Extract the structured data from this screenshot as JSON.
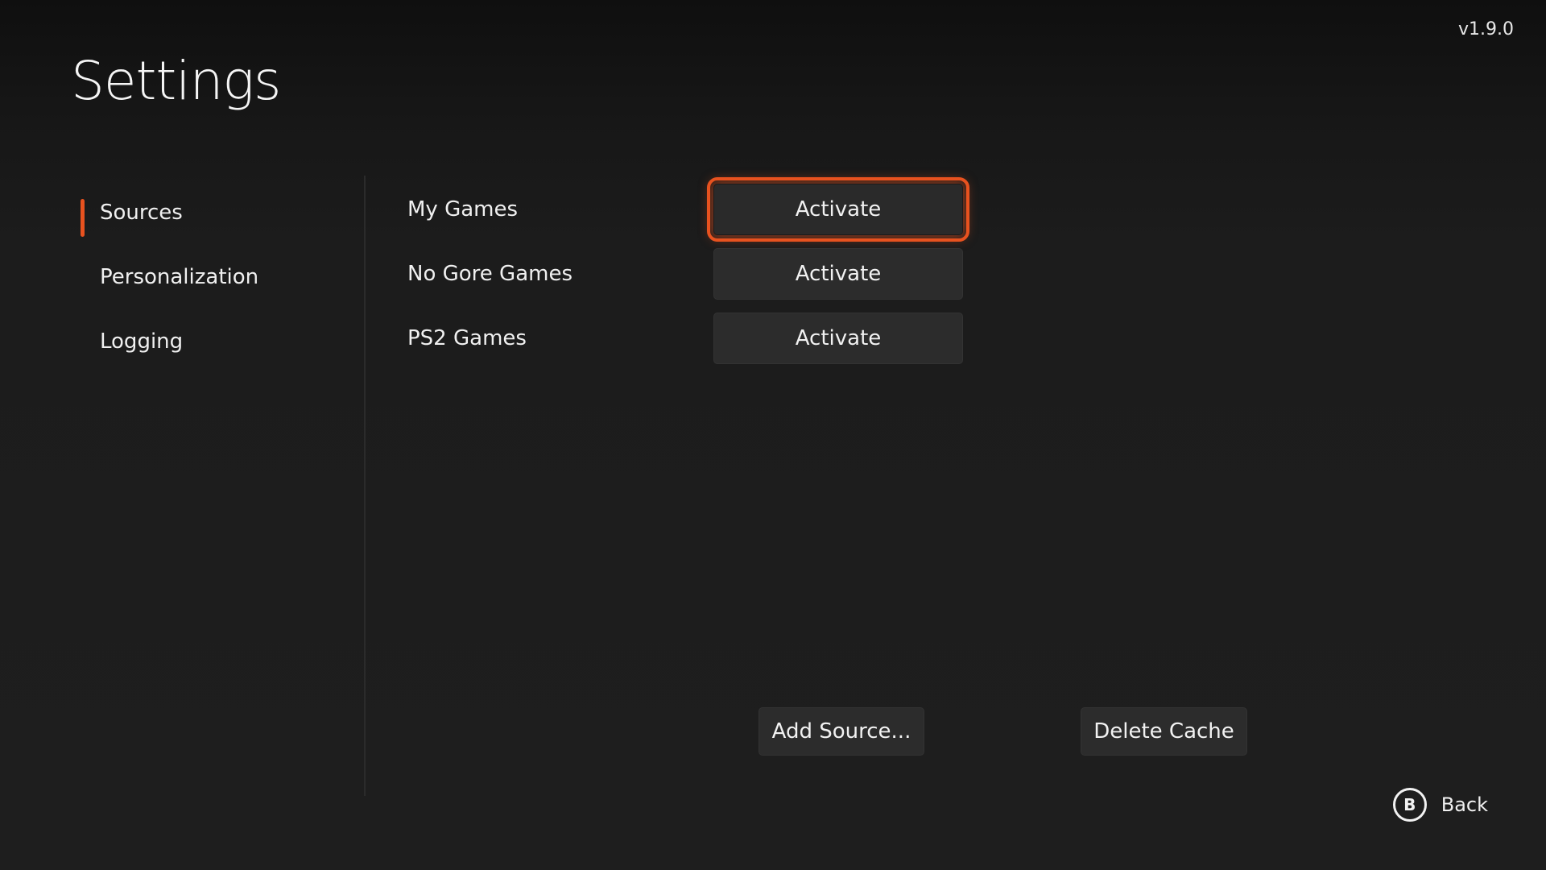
{
  "app": {
    "version": "v1.9.0",
    "title": "Settings"
  },
  "sidebar": {
    "items": [
      {
        "label": "Sources",
        "selected": true
      },
      {
        "label": "Personalization",
        "selected": false
      },
      {
        "label": "Logging",
        "selected": false
      }
    ]
  },
  "sources": {
    "rows": [
      {
        "name": "My Games",
        "action_label": "Activate",
        "focused": true
      },
      {
        "name": "No Gore Games",
        "action_label": "Activate",
        "focused": false
      },
      {
        "name": "PS2 Games",
        "action_label": "Activate",
        "focused": false
      }
    ],
    "add_source_label": "Add Source...",
    "delete_cache_label": "Delete Cache"
  },
  "footer": {
    "back_button_glyph": "B",
    "back_label": "Back"
  },
  "colors": {
    "accent": "#e8521f",
    "background": "#1e1e1e",
    "button_bg": "#2c2c2c",
    "text": "#f2f2f2"
  },
  "icons": {
    "back": "b-button-icon"
  }
}
